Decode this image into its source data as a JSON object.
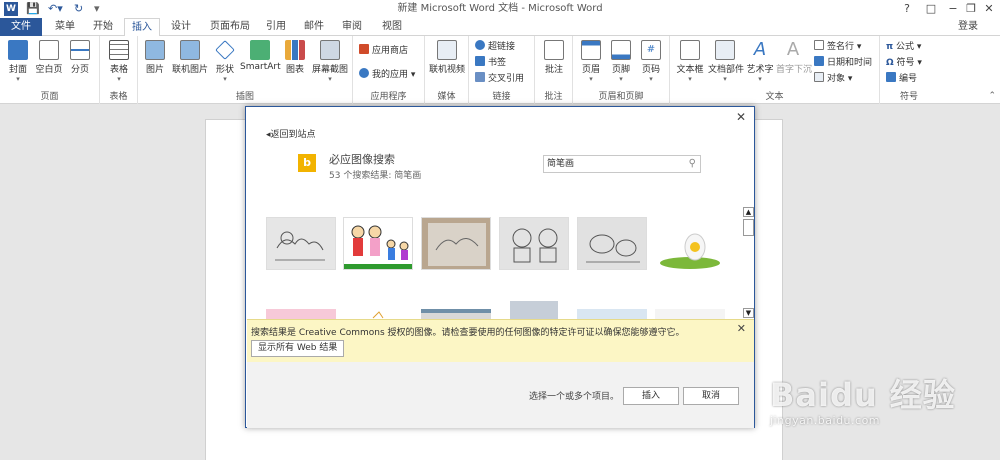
{
  "window": {
    "title": "新建 Microsoft Word 文档 - Microsoft Word",
    "help": "?",
    "controls": [
      "−",
      "❐",
      "✕"
    ]
  },
  "tabs": [
    "文件",
    "菜单",
    "开始",
    "插入",
    "设计",
    "页面布局",
    "引用",
    "邮件",
    "审阅",
    "视图"
  ],
  "active_tab": "插入",
  "signin": "登录",
  "ribbon": {
    "groups": {
      "pages": {
        "label": "页面",
        "items": [
          "封面",
          "空白页",
          "分页"
        ]
      },
      "tables": {
        "label": "表格",
        "items": [
          "表格"
        ]
      },
      "illustrations": {
        "label": "插图",
        "items": [
          "图片",
          "联机图片",
          "形状",
          "SmartArt",
          "图表",
          "屏幕截图"
        ]
      },
      "apps": {
        "label": "应用程序",
        "items": [
          "应用商店",
          "我的应用"
        ]
      },
      "media": {
        "label": "媒体",
        "items": [
          "联机视频"
        ]
      },
      "links": {
        "label": "链接",
        "items": [
          "超链接",
          "书签",
          "交叉引用"
        ]
      },
      "comments": {
        "label": "批注",
        "items": [
          "批注"
        ]
      },
      "header_footer": {
        "label": "页眉和页脚",
        "items": [
          "页眉",
          "页脚",
          "页码"
        ]
      },
      "text": {
        "label": "文本",
        "items": [
          "文本框",
          "文档部件",
          "艺术字",
          "首字下沉",
          "签名行",
          "日期和时间",
          "对象"
        ]
      },
      "symbols": {
        "label": "符号",
        "items": [
          "公式",
          "符号",
          "编号"
        ]
      }
    }
  },
  "dialog": {
    "back": "返回到站点",
    "source": "必应图像搜索",
    "result_count": "53 个搜索结果: 简笔画",
    "search_value": "简笔画",
    "notice": "搜索结果是 Creative Commons 授权的图像。请检查要使用的任何图像的特定许可证以确保您能够遵守它。",
    "show_all_button": "显示所有 Web 结果",
    "hint": "选择一个或多个项目。",
    "insert_button": "插入",
    "cancel_button": "取消"
  },
  "watermark": {
    "brand": "Baidu 经验",
    "url": "jingyan.baidu.com"
  },
  "colors": {
    "accent": "#2b579a",
    "notice_bg": "#fcf6c5",
    "bing": "#f2b300"
  }
}
